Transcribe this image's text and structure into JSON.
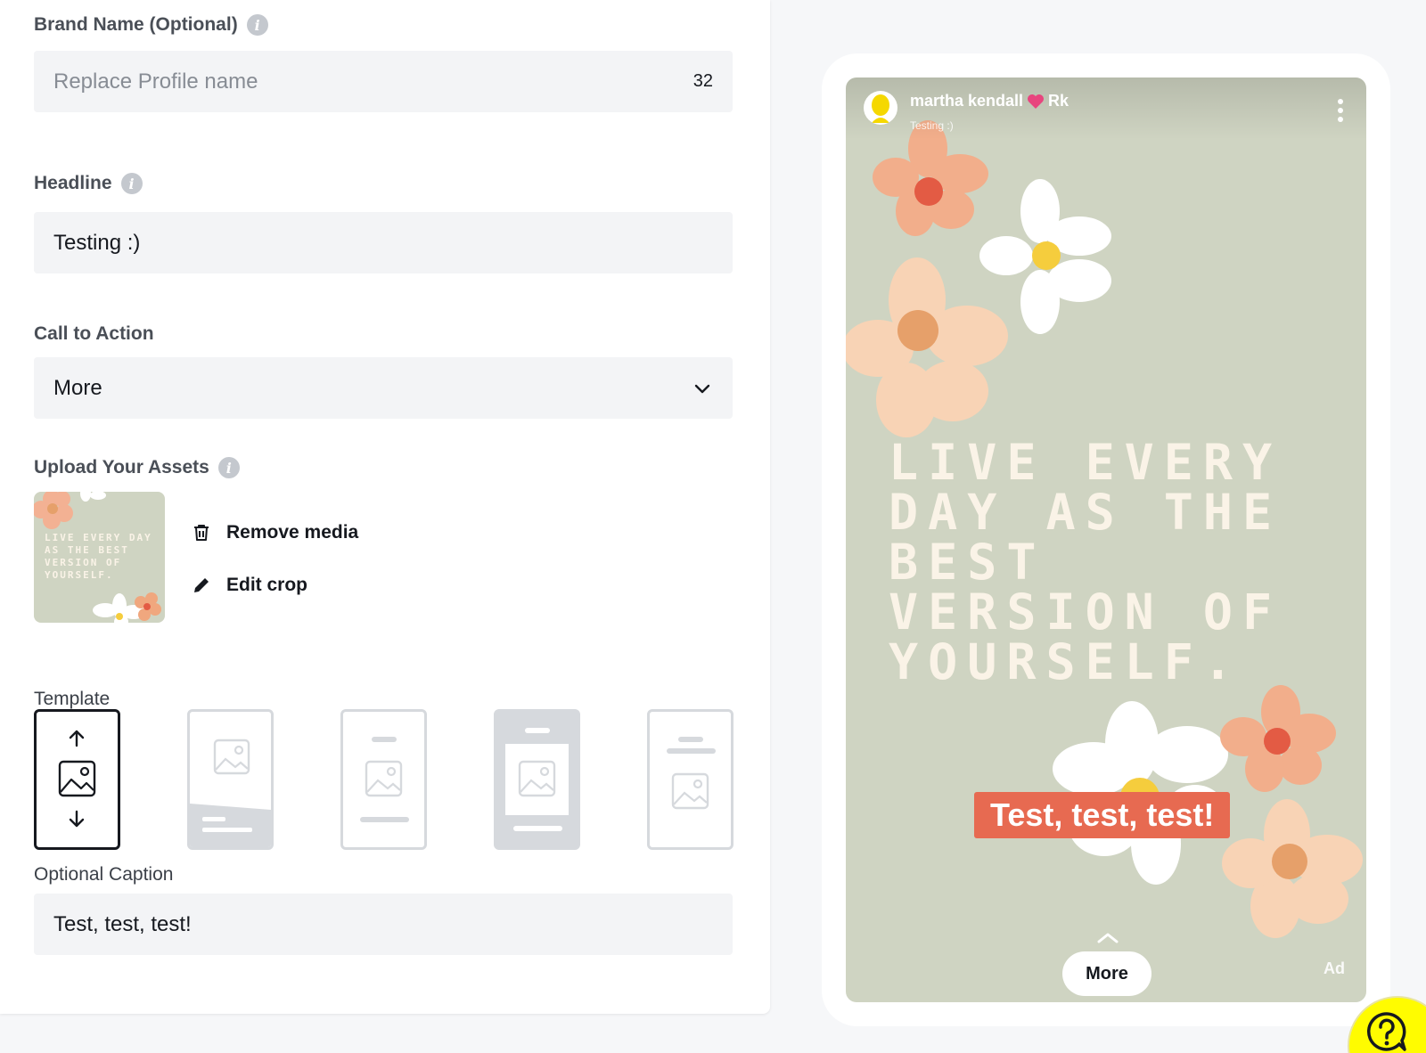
{
  "form": {
    "brand_name": {
      "label": "Brand Name (Optional)",
      "placeholder": "Replace Profile name",
      "value": "",
      "counter": "32"
    },
    "headline": {
      "label": "Headline",
      "value": "Testing :)"
    },
    "cta": {
      "label": "Call to Action",
      "value": "More"
    },
    "assets": {
      "label": "Upload Your Assets",
      "thumb_text": "LIVE EVERY DAY AS THE BEST VERSION OF YOURSELF.",
      "remove_label": "Remove media",
      "edit_crop_label": "Edit crop"
    },
    "template": {
      "label": "Template",
      "selected_index": 0
    },
    "caption": {
      "label": "Optional Caption",
      "value": "Test, test, test!"
    }
  },
  "preview": {
    "user_name": "martha kendall",
    "user_suffix": "Rk",
    "subtitle": "Testing :)",
    "quote": "LIVE EVERY DAY AS THE BEST VERSION OF YOURSELF.",
    "caption": "Test, test, test!",
    "cta": "More",
    "ad_tag": "Ad"
  },
  "icons": {
    "info": "info-icon",
    "chevron": "chevron-down-icon",
    "trash": "trash-icon",
    "pencil": "pencil-icon",
    "kebab": "kebab-menu-icon",
    "help": "help-chat-icon"
  },
  "colors": {
    "story_background": "#cfd4c2",
    "caption_pill": "#e76a51",
    "help_button": "#fffc00",
    "quote_text": "#faf3e7"
  }
}
